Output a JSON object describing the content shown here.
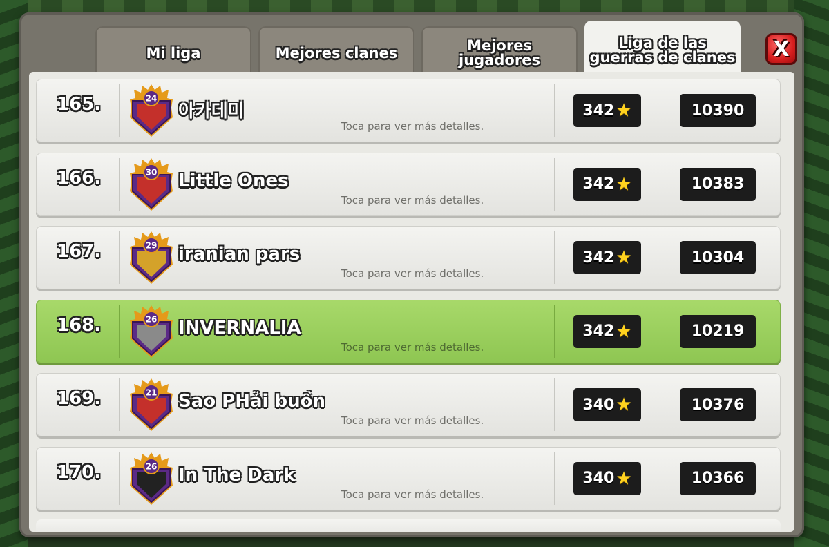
{
  "tabs": [
    {
      "label": "Mi liga",
      "active": false
    },
    {
      "label": "Mejores clanes",
      "active": false
    },
    {
      "label": "Mejores jugadores",
      "active": false
    },
    {
      "label": "Liga de las guerras de clanes",
      "active": true
    }
  ],
  "close_label": "X",
  "colors": {
    "highlight_row": "#98cd5c",
    "badge_purple": "#5b2a86",
    "badge_gold": "#e59a1a",
    "star": "#ffd21f"
  },
  "rows": [
    {
      "rank": "165.",
      "clan_level": "24",
      "name": "아카데미",
      "hint": "Toca para ver más detalles.",
      "stars": "342",
      "score": "10390",
      "highlighted": false,
      "badge_icon": "clan-badge-red-flame-icon",
      "badge_color": "#c4302b"
    },
    {
      "rank": "166.",
      "clan_level": "30",
      "name": "Little Ones",
      "hint": "Toca para ver más detalles.",
      "stars": "342",
      "score": "10383",
      "highlighted": false,
      "badge_icon": "clan-badge-red-flame-icon",
      "badge_color": "#c4302b"
    },
    {
      "rank": "167.",
      "clan_level": "29",
      "name": "iranian pars",
      "hint": "Toca para ver más detalles.",
      "stars": "342",
      "score": "10304",
      "highlighted": false,
      "badge_icon": "clan-badge-yellow-stripe-icon",
      "badge_color": "#d4a22a"
    },
    {
      "rank": "168.",
      "clan_level": "26",
      "name": "INVERNALIA",
      "hint": "Toca para ver más detalles.",
      "stars": "342",
      "score": "10219",
      "highlighted": true,
      "badge_icon": "clan-badge-chevron-icon",
      "badge_color": "#8a8a8a"
    },
    {
      "rank": "169.",
      "clan_level": "21",
      "name": "Sao PHải buồn",
      "hint": "Toca para ver más detalles.",
      "stars": "340",
      "score": "10376",
      "highlighted": false,
      "badge_icon": "clan-badge-red-white-icon",
      "badge_color": "#c4302b"
    },
    {
      "rank": "170.",
      "clan_level": "26",
      "name": "In The Dark",
      "hint": "Toca para ver más detalles.",
      "stars": "340",
      "score": "10366",
      "highlighted": false,
      "badge_icon": "clan-badge-black-chevron-icon",
      "badge_color": "#222222"
    }
  ]
}
